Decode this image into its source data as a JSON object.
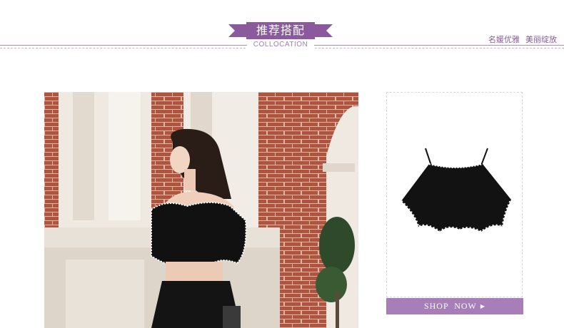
{
  "section_header": {
    "title": "推荐搭配",
    "subtitle": "COLLOCATION",
    "slogan": [
      "名媛优雅",
      "美丽绽放"
    ]
  },
  "colors": {
    "accent": "#8a5a9c",
    "button": "#a77eb8",
    "divider": "#b48bc4"
  },
  "model_photo": {
    "icon": "model-photo"
  },
  "product": {
    "icon": "black-crop-top-product",
    "shop_label": "SHOP  NOW",
    "arrow": "▶"
  }
}
